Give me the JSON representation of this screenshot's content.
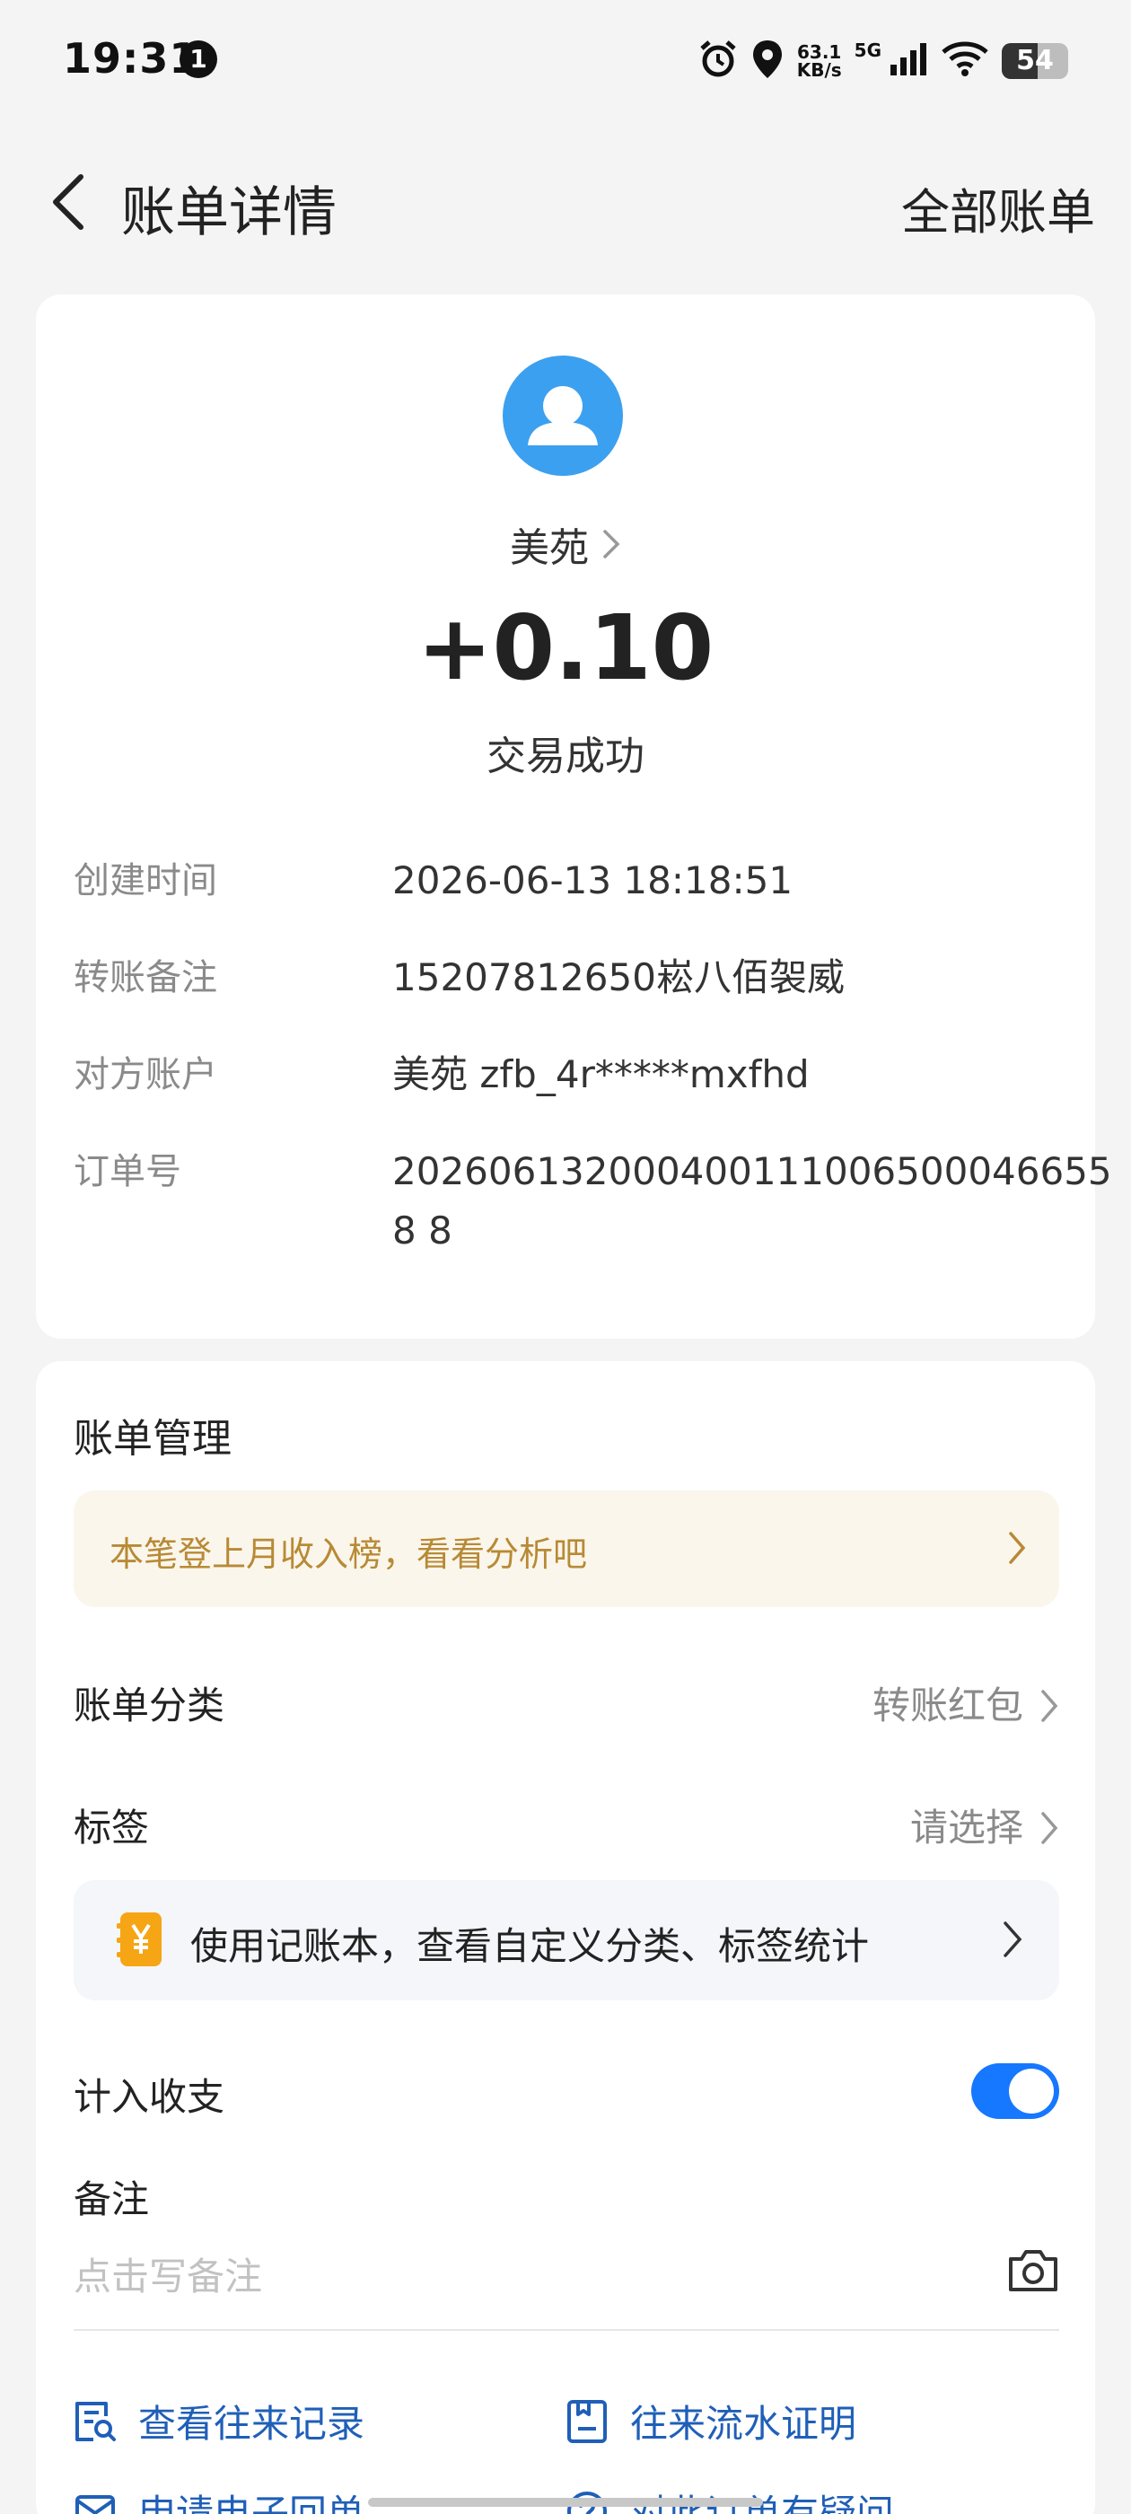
{
  "status_bar": {
    "time": "19:31",
    "notification_count": "1",
    "net_speed_value": "63.1",
    "net_speed_unit": "KB/s",
    "network_type": "5G",
    "battery_level": "54",
    "battery_fraction": 0.54,
    "icons": [
      "alarm-icon",
      "location-icon",
      "signal-icon",
      "wifi-icon",
      "battery-icon"
    ]
  },
  "header": {
    "title": "账单详情",
    "all_bills_label": "全部账单",
    "back_icon": "chevron-left-icon"
  },
  "transaction": {
    "counterparty_name": "美苑",
    "amount": "+0.10",
    "status": "交易成功",
    "avatar_color": "#3ca0f0"
  },
  "details": [
    {
      "label": "创建时间",
      "value": "2026-06-13 18:18:51"
    },
    {
      "label": "转账备注",
      "value": "15207812650崧八佰袈威"
    },
    {
      "label": "对方账户",
      "value": "美苑 zfb_4r*****mxfhd"
    },
    {
      "label": "订单号",
      "value": "2026061320004001110065000466558 8"
    }
  ],
  "management": {
    "title": "账单管理",
    "promo_text": "本笔登上月收入榜，看看分析吧",
    "promo_color": "#b88a35",
    "category_label": "账单分类",
    "category_value": "转账红包",
    "tag_label": "标签",
    "tag_value": "请选择",
    "notebook_banner": "使用记账本，查看自定义分类、标签统计",
    "include_label": "计入收支",
    "include_on": true,
    "toggle_color": "#1677ff",
    "remark_label": "备注",
    "remark_placeholder": "点击写备注",
    "remark_value": ""
  },
  "actions": [
    {
      "label": "查看往来记录",
      "icon": "record-search-icon"
    },
    {
      "label": "往来流水证明",
      "icon": "document-icon"
    },
    {
      "label": "申请电子回单",
      "icon": "mail-icon"
    },
    {
      "label": "对此订单有疑问",
      "icon": "question-icon"
    }
  ],
  "accent_color": "#1f5fb8"
}
